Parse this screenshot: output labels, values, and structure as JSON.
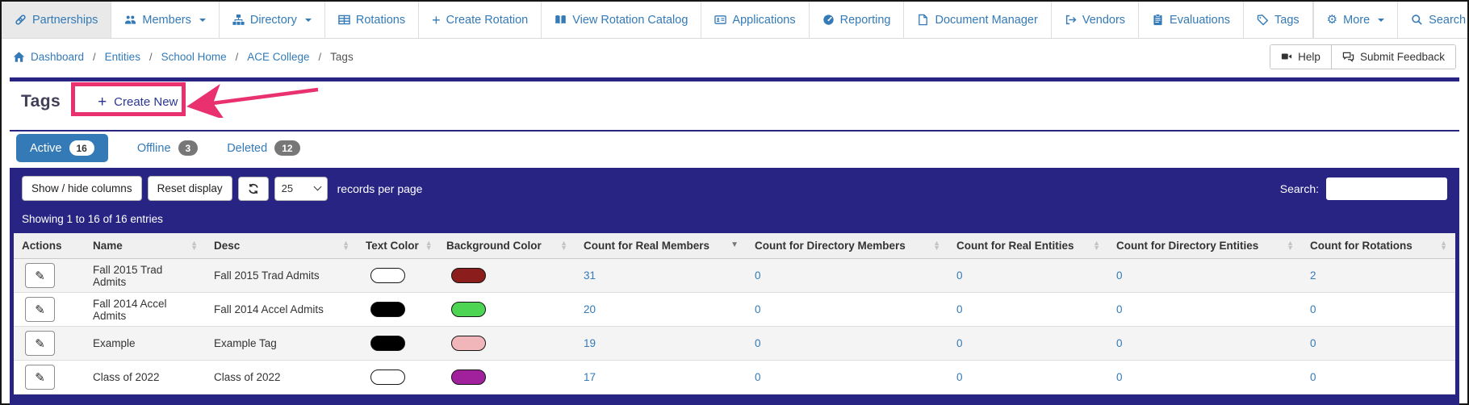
{
  "colors": {
    "navy": "#272484",
    "link_blue": "#337ab7",
    "annotation_pink": "#e8316e",
    "badge_gray": "#777777"
  },
  "glyphs": {
    "pencil": "✎",
    "gear": "⚙",
    "plus": "+"
  },
  "nav": {
    "items": [
      {
        "label": "Partnerships",
        "icon": "link-icon",
        "active": true,
        "caret": false
      },
      {
        "label": "Members",
        "icon": "users-icon",
        "active": false,
        "caret": true
      },
      {
        "label": "Directory",
        "icon": "sitemap-icon",
        "active": false,
        "caret": true
      },
      {
        "label": "Rotations",
        "icon": "table-icon",
        "active": false,
        "caret": false
      },
      {
        "label": "Create Rotation",
        "icon": "plus-icon",
        "active": false,
        "caret": false
      },
      {
        "label": "View Rotation Catalog",
        "icon": "book-icon",
        "active": false,
        "caret": false
      },
      {
        "label": "Applications",
        "icon": "id-card-icon",
        "active": false,
        "caret": false
      },
      {
        "label": "Reporting",
        "icon": "gauge-icon",
        "active": false,
        "caret": false
      },
      {
        "label": "Document Manager",
        "icon": "file-icon",
        "active": false,
        "caret": false
      },
      {
        "label": "Vendors",
        "icon": "sign-out-icon",
        "active": false,
        "caret": false
      },
      {
        "label": "Evaluations",
        "icon": "clipboard-icon",
        "active": false,
        "caret": false
      },
      {
        "label": "Tags",
        "icon": "tag-icon",
        "active": false,
        "caret": false
      },
      {
        "label": "More",
        "icon": "gear-icon",
        "active": false,
        "caret": true
      },
      {
        "label": "Search",
        "icon": "search-icon",
        "active": false,
        "caret": true
      }
    ]
  },
  "breadcrumb": {
    "separator": "/",
    "items": [
      "Dashboard",
      "Entities",
      "School Home",
      "ACE College"
    ],
    "current": "Tags"
  },
  "header_actions": {
    "help_label": "Help",
    "feedback_label": "Submit Feedback"
  },
  "page": {
    "title": "Tags",
    "create_new_plus": "+",
    "create_new_label": "Create New"
  },
  "tabs": [
    {
      "label": "Active",
      "count": "16",
      "active": true
    },
    {
      "label": "Offline",
      "count": "3",
      "active": false
    },
    {
      "label": "Deleted",
      "count": "12",
      "active": false
    }
  ],
  "toolbar": {
    "show_hide_label": "Show / hide columns",
    "reset_label": "Reset display",
    "page_size_value": "25",
    "records_per_page_label": "records per page",
    "search_label": "Search:",
    "search_value": ""
  },
  "table": {
    "showing_text": "Showing 1 to 16 of 16 entries",
    "columns": [
      {
        "label": "Actions",
        "sort": "none"
      },
      {
        "label": "Name",
        "sort": "both"
      },
      {
        "label": "Desc",
        "sort": "both"
      },
      {
        "label": "Text Color",
        "sort": "both"
      },
      {
        "label": "Background Color",
        "sort": "both"
      },
      {
        "label": "Count for Real Members",
        "sort": "desc"
      },
      {
        "label": "Count for Directory Members",
        "sort": "both"
      },
      {
        "label": "Count for Real Entities",
        "sort": "both"
      },
      {
        "label": "Count for Directory Entities",
        "sort": "both"
      },
      {
        "label": "Count for Rotations",
        "sort": "both"
      }
    ],
    "rows": [
      {
        "name": "Fall 2015 Trad Admits",
        "desc": "Fall 2015 Trad Admits",
        "text_color": "#ffffff",
        "background_color": "#8b1d1d",
        "counts": [
          "31",
          "0",
          "0",
          "0",
          "2"
        ]
      },
      {
        "name": "Fall 2014 Accel Admits",
        "desc": "Fall 2014 Accel Admits",
        "text_color": "#000000",
        "background_color": "#4dd452",
        "counts": [
          "20",
          "0",
          "0",
          "0",
          "0"
        ]
      },
      {
        "name": "Example",
        "desc": "Example Tag",
        "text_color": "#000000",
        "background_color": "#f1b6ba",
        "counts": [
          "19",
          "0",
          "0",
          "0",
          "0"
        ]
      },
      {
        "name": "Class of 2022",
        "desc": "Class of 2022",
        "text_color": "#ffffff",
        "background_color": "#a1219d",
        "counts": [
          "17",
          "0",
          "0",
          "0",
          "0"
        ]
      }
    ]
  }
}
